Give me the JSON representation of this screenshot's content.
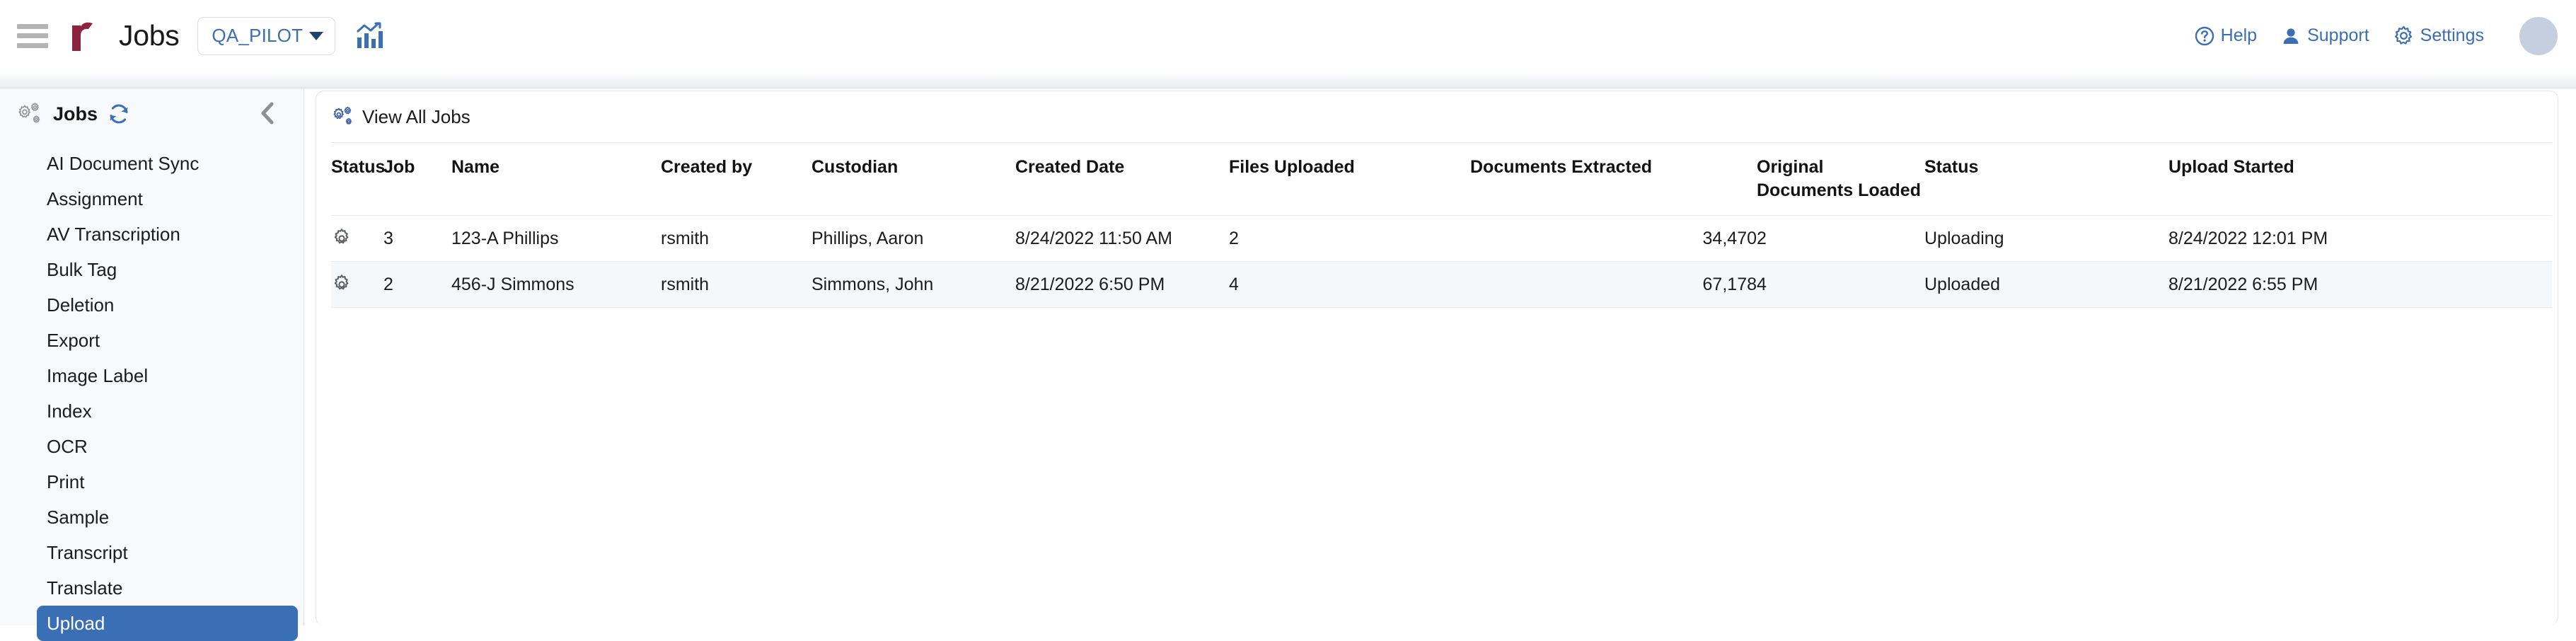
{
  "topbar": {
    "menu_icon": "hamburger-icon",
    "logo_icon": "relativity-r-logo",
    "title": "Jobs",
    "workspace": {
      "selected": "QA_PILOT",
      "caret_icon": "chevron-down-icon"
    },
    "analytics_icon": "analytics-chart-icon",
    "links": [
      {
        "label": "Help",
        "icon": "help-circle-icon"
      },
      {
        "label": "Support",
        "icon": "user-support-icon"
      },
      {
        "label": "Settings",
        "icon": "gear-icon"
      }
    ],
    "avatar_icon": "user-avatar"
  },
  "sidebar": {
    "icon": "gears-icon",
    "title": "Jobs",
    "refresh_icon": "refresh-icon",
    "collapse_icon": "chevron-left-icon",
    "items": [
      {
        "label": "AI Document Sync",
        "active": false
      },
      {
        "label": "Assignment",
        "active": false
      },
      {
        "label": "AV Transcription",
        "active": false
      },
      {
        "label": "Bulk Tag",
        "active": false
      },
      {
        "label": "Deletion",
        "active": false
      },
      {
        "label": "Export",
        "active": false
      },
      {
        "label": "Image Label",
        "active": false
      },
      {
        "label": "Index",
        "active": false
      },
      {
        "label": "OCR",
        "active": false
      },
      {
        "label": "Print",
        "active": false
      },
      {
        "label": "Sample",
        "active": false
      },
      {
        "label": "Transcript",
        "active": false
      },
      {
        "label": "Translate",
        "active": false
      },
      {
        "label": "Upload",
        "active": true
      }
    ]
  },
  "main": {
    "card_head": {
      "icon": "gears-icon-blue",
      "label": "View All Jobs"
    },
    "table": {
      "columns": [
        "Status",
        "Job",
        "Name",
        "Created by",
        "Custodian",
        "Created Date",
        "Files Uploaded",
        "Documents Extracted",
        "Original Documents Loaded",
        "Status",
        "Upload Started"
      ],
      "rows": [
        {
          "status_icon": "gear-icon",
          "job": "3",
          "name": "123-A Phillips",
          "created_by": "rsmith",
          "custodian": "Phillips, Aaron",
          "created_date": "8/24/2022 11:50 AM",
          "files_uploaded": "2",
          "documents_extracted": "34,470",
          "original_documents_loaded": "2",
          "status": "Uploading",
          "upload_started": "8/24/2022 12:01 PM"
        },
        {
          "status_icon": "gear-icon",
          "job": "2",
          "name": "456-J Simmons",
          "created_by": "rsmith",
          "custodian": "Simmons, John",
          "created_date": "8/21/2022 6:50 PM",
          "files_uploaded": "4",
          "documents_extracted": "67,178",
          "original_documents_loaded": "4",
          "status": "Uploaded",
          "upload_started": "8/21/2022 6:55 PM"
        }
      ]
    }
  },
  "colors": {
    "accent_blue": "#3b6fb5",
    "logo_maroon": "#8c2341",
    "sidebar_bg": "#f7f9fc",
    "alt_row_bg": "#f5f8fb",
    "avatar_bg": "#c4d0e0"
  }
}
